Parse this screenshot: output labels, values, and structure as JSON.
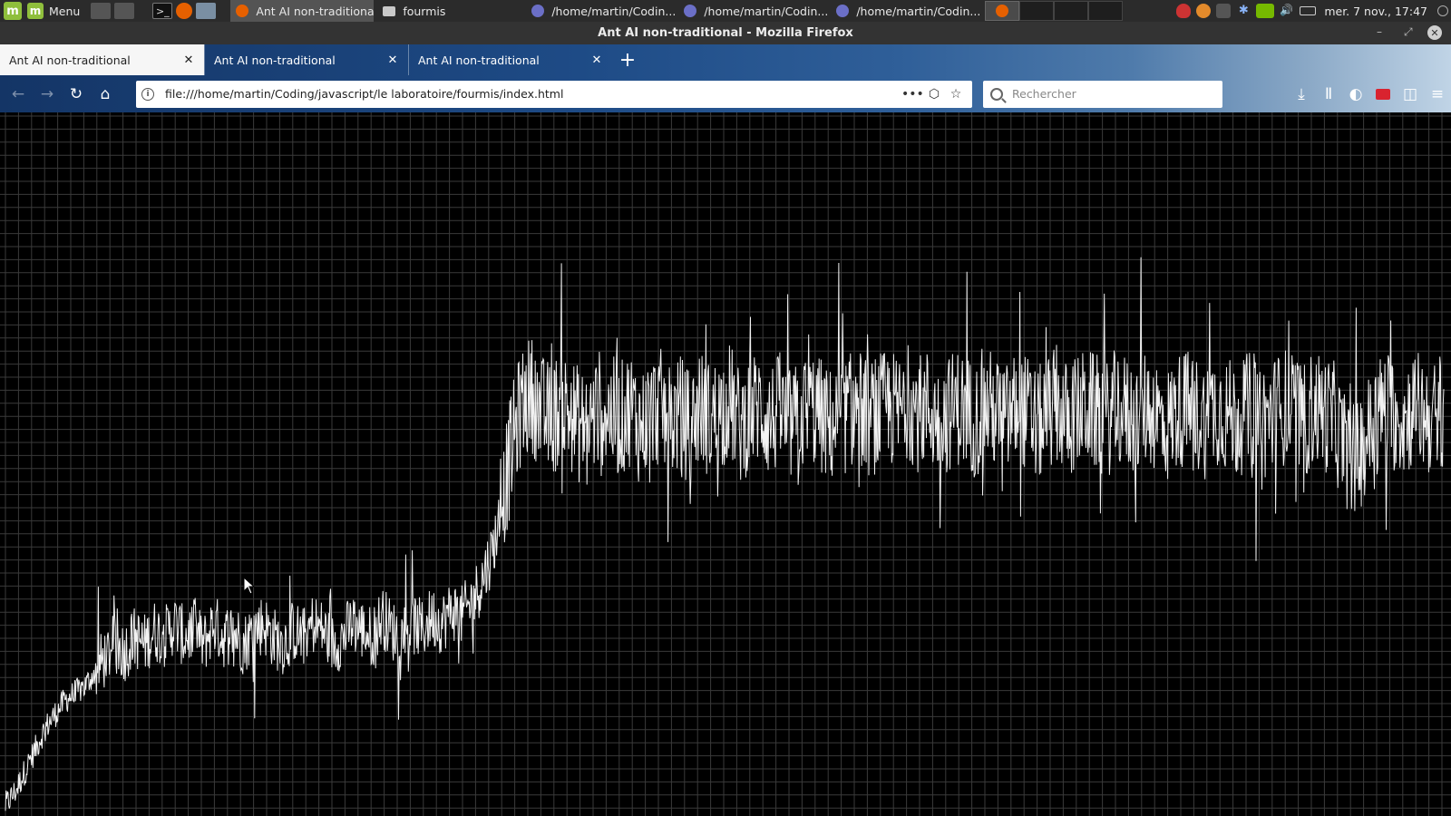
{
  "taskbar": {
    "menu_label": "Menu",
    "tasks": [
      {
        "label": "Ant AI non-traditiona...",
        "active": true,
        "icon": "firefox-icon"
      },
      {
        "label": "fourmis",
        "active": false,
        "icon": "folder-icon"
      },
      {
        "label": "/home/martin/Codin...",
        "active": false,
        "icon": "editor-icon"
      },
      {
        "label": "/home/martin/Codin...",
        "active": false,
        "icon": "editor-icon"
      },
      {
        "label": "/home/martin/Codin...",
        "active": false,
        "icon": "editor-icon"
      }
    ],
    "clock": "mer. 7 nov., 17:47"
  },
  "window": {
    "title": "Ant AI non-traditional - Mozilla Firefox"
  },
  "browser": {
    "tabs": [
      {
        "title": "Ant AI non-traditional",
        "selected": true
      },
      {
        "title": "Ant AI non-traditional",
        "selected": false
      },
      {
        "title": "Ant AI non-traditional",
        "selected": false
      }
    ],
    "url": "file:///home/martin/Coding/javascript/le laboratoire/fourmis/index.html",
    "search_placeholder": "Rechercher"
  },
  "page": {
    "background": "#000000",
    "grid_color": "#3a3a3a",
    "line_color": "#f2f2f2"
  },
  "chart_data": {
    "type": "line",
    "title": "",
    "xlabel": "",
    "ylabel": "",
    "grid": true,
    "series": [
      {
        "description_free_values_note": "",
        "values": [
          0.01,
          0.03,
          0.06,
          0.09,
          0.12,
          0.14,
          0.16,
          0.17,
          0.18,
          0.2,
          0.22,
          0.24,
          0.23,
          0.25,
          0.24,
          0.26,
          0.25,
          0.27,
          0.25,
          0.26,
          0.24,
          0.27,
          0.25,
          0.26,
          0.24,
          0.26,
          0.27,
          0.25,
          0.24,
          0.26,
          0.25,
          0.27,
          0.26,
          0.24,
          0.25,
          0.27,
          0.26,
          0.25,
          0.28,
          0.26,
          0.25,
          0.27,
          0.26,
          0.28,
          0.27,
          0.29,
          0.28,
          0.3,
          0.33,
          0.37,
          0.43,
          0.52,
          0.58,
          0.6,
          0.57,
          0.56,
          0.58,
          0.57,
          0.55,
          0.56,
          0.58,
          0.57,
          0.56,
          0.58,
          0.55,
          0.57,
          0.58,
          0.56,
          0.57,
          0.55,
          0.58,
          0.56,
          0.57,
          0.59,
          0.55,
          0.57,
          0.58,
          0.56,
          0.57,
          0.55,
          0.56,
          0.58,
          0.57,
          0.55,
          0.56,
          0.57,
          0.58,
          0.56,
          0.57,
          0.58,
          0.57,
          0.59,
          0.57,
          0.58,
          0.56,
          0.57,
          0.58,
          0.57,
          0.56,
          0.58,
          0.57,
          0.56,
          0.58,
          0.57,
          0.55,
          0.57,
          0.58,
          0.56,
          0.57,
          0.58,
          0.57,
          0.56,
          0.58,
          0.57,
          0.56,
          0.58,
          0.57,
          0.55,
          0.57,
          0.58,
          0.57,
          0.56,
          0.58,
          0.57,
          0.56,
          0.57,
          0.58,
          0.56,
          0.57,
          0.58,
          0.57,
          0.56,
          0.58,
          0.57,
          0.56,
          0.52,
          0.5,
          0.53,
          0.56,
          0.58,
          0.57,
          0.56,
          0.58,
          0.57,
          0.56,
          0.58
        ]
      }
    ]
  }
}
